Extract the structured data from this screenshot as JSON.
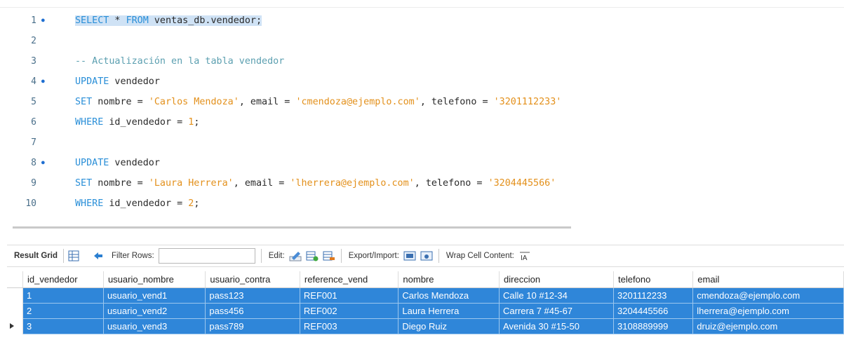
{
  "editor": {
    "lines": [
      {
        "num": "1",
        "dot": true,
        "html": "<span class=\"sel\"><span class=\"kw\">SELECT</span> * <span class=\"kw\">FROM</span> ventas_db.vendedor;</span>"
      },
      {
        "num": "2",
        "dot": false,
        "html": ""
      },
      {
        "num": "3",
        "dot": false,
        "html": "<span class=\"cmt\">-- Actualización en la tabla vendedor</span>"
      },
      {
        "num": "4",
        "dot": true,
        "html": "<span class=\"kw\">UPDATE</span> vendedor"
      },
      {
        "num": "5",
        "dot": false,
        "html": "<span class=\"kw\">SET</span> nombre = <span class=\"str\">'Carlos Mendoza'</span>, email = <span class=\"str\">'cmendoza@ejemplo.com'</span>, telefono = <span class=\"str\">'3201112233'</span>"
      },
      {
        "num": "6",
        "dot": false,
        "html": "<span class=\"kw\">WHERE</span> id_vendedor = <span class=\"str\">1</span>;"
      },
      {
        "num": "7",
        "dot": false,
        "html": ""
      },
      {
        "num": "8",
        "dot": true,
        "html": "<span class=\"kw\">UPDATE</span> vendedor"
      },
      {
        "num": "9",
        "dot": false,
        "html": "<span class=\"kw\">SET</span> nombre = <span class=\"str\">'Laura Herrera'</span>, email = <span class=\"str\">'lherrera@ejemplo.com'</span>, telefono = <span class=\"str\">'3204445566'</span>"
      },
      {
        "num": "10",
        "dot": false,
        "html": "<span class=\"kw\">WHERE</span> id_vendedor = <span class=\"str\">2</span>;"
      }
    ]
  },
  "toolbar": {
    "result_grid": "Result Grid",
    "filter_rows": "Filter Rows:",
    "filter_value": "",
    "edit": "Edit:",
    "export_import": "Export/Import:",
    "wrap_cell": "Wrap Cell Content:"
  },
  "grid": {
    "columns": [
      "id_vendedor",
      "usuario_nombre",
      "usuario_contra",
      "reference_vend",
      "nombre",
      "direccion",
      "telefono",
      "email"
    ],
    "rows": [
      [
        "1",
        "usuario_vend1",
        "pass123",
        "REF001",
        "Carlos Mendoza",
        "Calle 10 #12-34",
        "3201112233",
        "cmendoza@ejemplo.com"
      ],
      [
        "2",
        "usuario_vend2",
        "pass456",
        "REF002",
        "Laura Herrera",
        "Carrera 7 #45-67",
        "3204445566",
        "lherrera@ejemplo.com"
      ],
      [
        "3",
        "usuario_vend3",
        "pass789",
        "REF003",
        "Diego Ruiz",
        "Avenida 30 #15-50",
        "3108889999",
        "druiz@ejemplo.com"
      ]
    ],
    "selected_color": "#2f86d9"
  },
  "icons": [
    "grid-view-icon",
    "refresh-icon",
    "edit-pencil-icon",
    "add-row-icon",
    "delete-row-icon",
    "export-icon",
    "import-icon",
    "wrap-text-icon",
    "row-pointer-icon"
  ]
}
